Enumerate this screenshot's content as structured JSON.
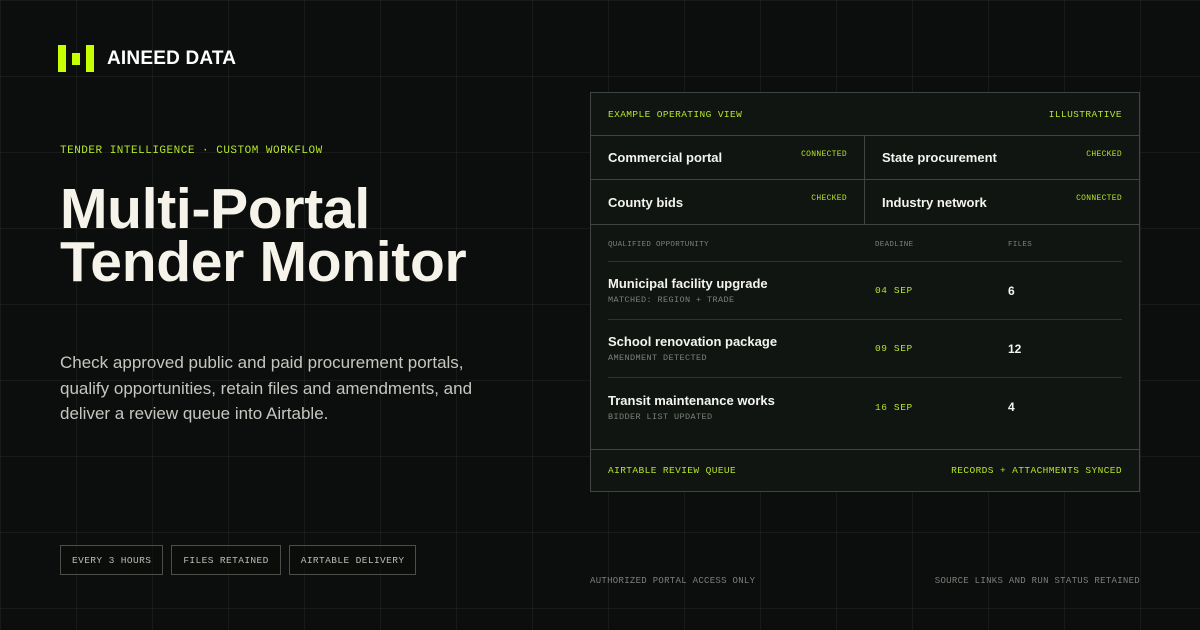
{
  "brand": {
    "name": "AINEED DATA",
    "accent": "#c6ff00",
    "logo_icon": "three-bar-logo-icon"
  },
  "hero": {
    "eyebrow": "TENDER INTELLIGENCE · CUSTOM WORKFLOW",
    "title_line1": "Multi-Portal",
    "title_line2": "Tender Monitor",
    "description": "Check approved public and paid procurement portals, qualify opportunities, retain files and amendments, and deliver a review queue into Airtable."
  },
  "tags": [
    "EVERY 3 HOURS",
    "FILES RETAINED",
    "AIRTABLE DELIVERY"
  ],
  "panel": {
    "header_left": "EXAMPLE OPERATING VIEW",
    "header_right": "ILLUSTRATIVE",
    "portals": [
      {
        "name": "Commercial portal",
        "status": "CONNECTED"
      },
      {
        "name": "State procurement",
        "status": "CHECKED"
      },
      {
        "name": "County bids",
        "status": "CHECKED"
      },
      {
        "name": "Industry network",
        "status": "CONNECTED"
      }
    ],
    "columns": {
      "opportunity": "QUALIFIED OPPORTUNITY",
      "deadline": "DEADLINE",
      "files": "FILES"
    },
    "opportunities": [
      {
        "name": "Municipal facility upgrade",
        "note": "MATCHED: REGION + TRADE",
        "deadline": "04 SEP",
        "files": "6"
      },
      {
        "name": "School renovation package",
        "note": "AMENDMENT DETECTED",
        "deadline": "09 SEP",
        "files": "12"
      },
      {
        "name": "Transit maintenance works",
        "note": "BIDDER LIST UPDATED",
        "deadline": "16 SEP",
        "files": "4"
      }
    ],
    "footer_left": "AIRTABLE REVIEW QUEUE",
    "footer_right": "RECORDS + ATTACHMENTS SYNCED"
  },
  "notes": {
    "left": "AUTHORIZED PORTAL ACCESS ONLY",
    "right": "SOURCE LINKS AND RUN STATUS RETAINED"
  },
  "colors": {
    "background": "#0b0e0c",
    "accent_text": "#b6e62a",
    "panel": "#111512"
  }
}
